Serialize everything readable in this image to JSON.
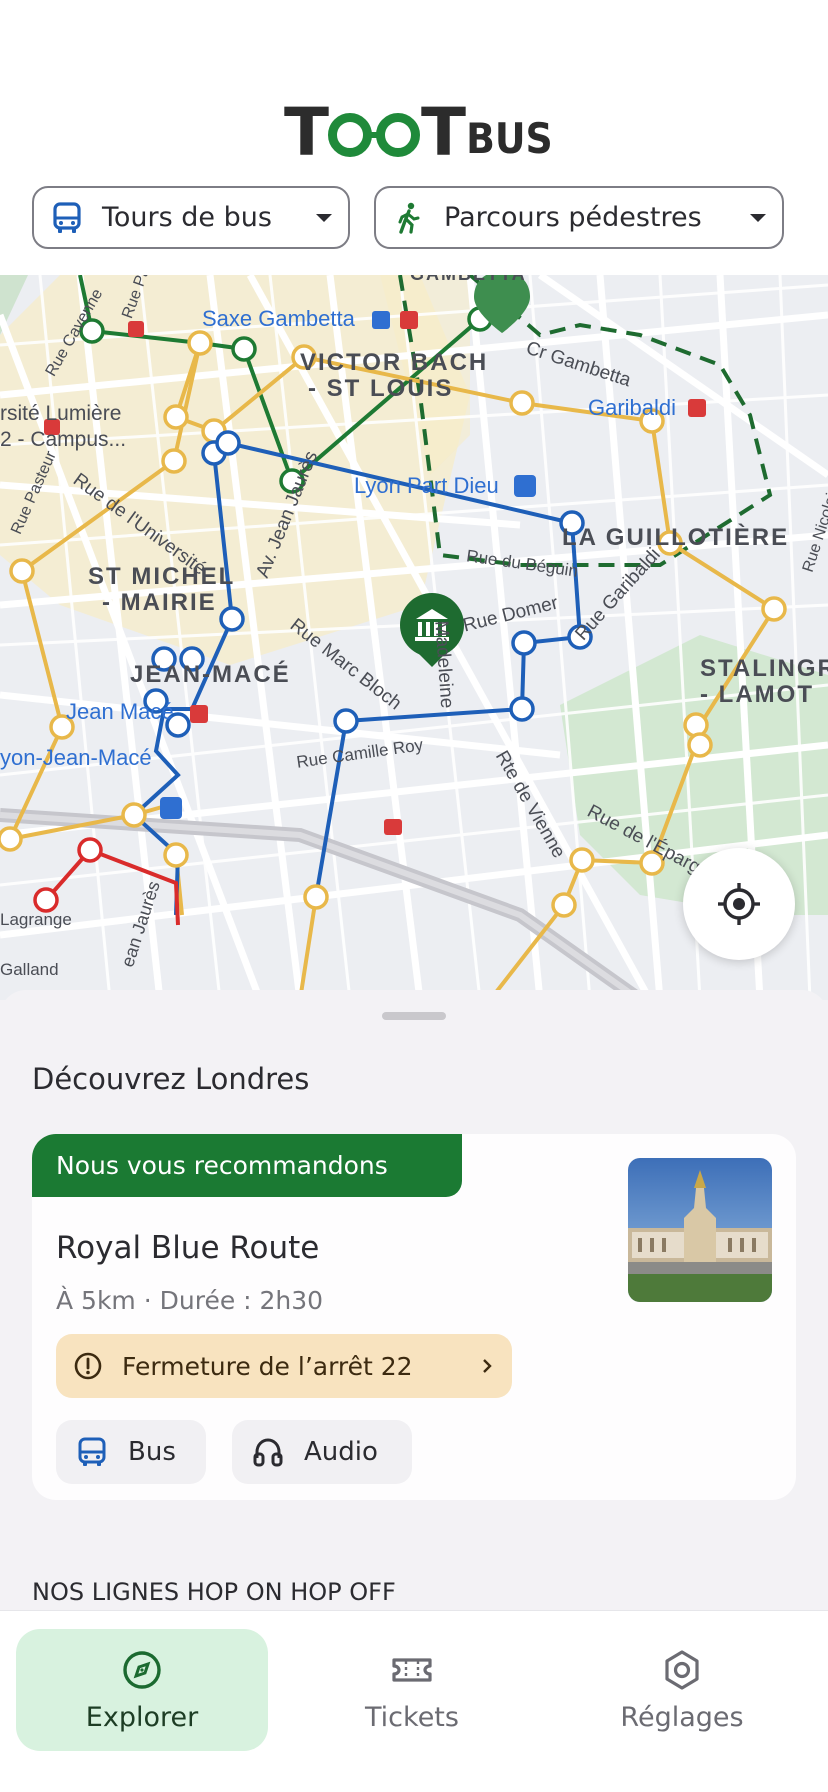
{
  "app": {
    "logo_main": "TOOT",
    "logo_sub": "BUS"
  },
  "filters": {
    "bus_tours": {
      "label": "Tours de bus",
      "icon": "bus-icon"
    },
    "walking_tours": {
      "label": "Parcours pédestres",
      "icon": "walking-person-icon"
    }
  },
  "map": {
    "areas": [
      "VICTOR BACH",
      "- ST LOUIS",
      "ST MICHEL",
      "- MAIRIE",
      "JEAN-MACÉ",
      "LA GUILLOTIÈRE",
      "STALINGR",
      "- LAMOT"
    ],
    "stations": [
      "Saxe Gambetta",
      "Lyon Part Dieu",
      "Jean Macé",
      "Garibaldi",
      "yon-Jean-Macé",
      "GAMBETTA"
    ],
    "streets": [
      "Cr Gambetta",
      "Rue de l'Université",
      "Av. Jean Jaurès",
      "Rue Marc Bloch",
      "Rue Domer",
      "Rue Garibaldi",
      "Rue Camille Roy",
      "Rte de Vienne",
      "Rue de l'Épargne",
      "Rue du Béguin",
      "Madeleine",
      "Rue Cavenne",
      "Rue Pasteur",
      "rsité Lumière",
      "2 - Campus...",
      "Lagrange",
      "Galland",
      "Rue Nicolai",
      "ean Jaurès",
      "Rue Pa"
    ],
    "colors": {
      "green_line": "#1e7a33",
      "yellow_line": "#e8b84a",
      "blue_line": "#1e5fb8",
      "red_line": "#d92b2b",
      "walking_route": "#1e6b30"
    }
  },
  "sheet": {
    "title": "Découvrez Londres",
    "card": {
      "badge": "Nous vous recommandons",
      "title": "Royal Blue Route",
      "meta": "À 5km · Durée : 2h30",
      "alert": "Fermeture de l’arrêt 22",
      "chips": [
        {
          "label": "Bus",
          "icon": "bus-icon"
        },
        {
          "label": "Audio",
          "icon": "headphones-icon"
        }
      ]
    },
    "section_title": "NOS LIGNES HOP ON HOP OFF"
  },
  "nav": {
    "items": [
      {
        "label": "Explorer",
        "icon": "compass-icon",
        "active": true
      },
      {
        "label": "Tickets",
        "icon": "ticket-icon",
        "active": false
      },
      {
        "label": "Réglages",
        "icon": "settings-icon",
        "active": false
      }
    ]
  }
}
